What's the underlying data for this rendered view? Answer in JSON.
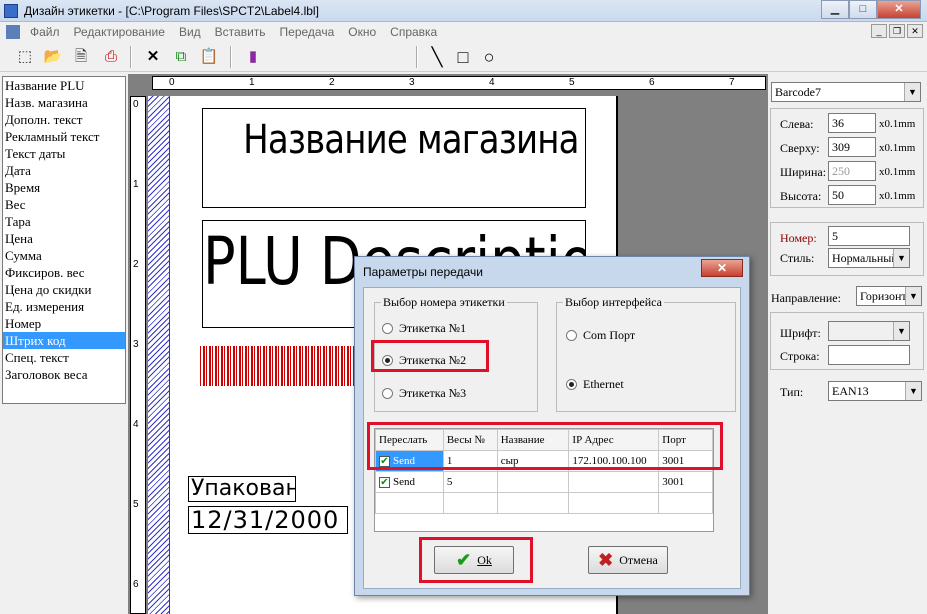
{
  "window": {
    "title": "Дизайн этикетки - [C:\\Program Files\\SPCT2\\Label4.lbl]",
    "minimize": "▁",
    "maximize": "□",
    "close": "✕"
  },
  "menu": [
    "Файл",
    "Редактирование",
    "Вид",
    "Вставить",
    "Передача",
    "Окно",
    "Справка"
  ],
  "fields": [
    "Название PLU",
    "Назв. магазина",
    "Дополн. текст",
    "Рекламный текст",
    "Текст даты",
    "Дата",
    "Время",
    "Вес",
    "Тара",
    "Цена",
    "Сумма",
    "Фиксиров. вес",
    "Цена до скидки",
    "Ед. измерения",
    "Номер",
    "Штрих код",
    "Спец. текст",
    "Заголовок веса"
  ],
  "selected_field": "Штрих код",
  "ruler": {
    "h": [
      "0",
      "1",
      "2",
      "3",
      "4",
      "5",
      "6",
      "7"
    ],
    "v": [
      "0",
      "1",
      "2",
      "3",
      "4",
      "5",
      "6"
    ]
  },
  "label": {
    "store_name": "Название магазина",
    "plu_description": "PLU Description",
    "text_packed": "Упаковано",
    "date": "12/31/2000"
  },
  "props": {
    "object": "Barcode7",
    "left_label": "Слева:",
    "left": "36",
    "top_label": "Сверху:",
    "top": "309",
    "width_label": "Ширина:",
    "width": "250",
    "height_label": "Высота:",
    "height": "50",
    "unit": "x0.1mm",
    "number_label": "Номер:",
    "number": "5",
    "style_label": "Стиль:",
    "style": "Нормальный",
    "direction_label": "Направление:",
    "direction": "Горизонт",
    "font_label": "Шрифт:",
    "font": "",
    "line_label": "Строка:",
    "line": "",
    "type_label": "Тип:",
    "type": "EAN13"
  },
  "dialog": {
    "title": "Параметры передачи",
    "close": "✕",
    "label_group": "Выбор номера этикетки",
    "label_options": [
      "Этикетка №1",
      "Этикетка №2",
      "Этикетка №3"
    ],
    "label_selected": 1,
    "iface_group": "Выбор интерфейса",
    "iface_options": [
      "Com Порт",
      "Ethernet"
    ],
    "iface_selected": 1,
    "table": {
      "headers": [
        "Переслать",
        "Весы №",
        "Название",
        "IP Адрес",
        "Порт"
      ],
      "rows": [
        [
          "Send",
          "1",
          "сыр",
          "172.100.100.100",
          "3001"
        ],
        [
          "Send",
          "5",
          "",
          "",
          "3001"
        ]
      ]
    },
    "ok": "Ok",
    "cancel": "Отмена",
    "colors": {
      "highlight": "#e0102a",
      "selection": "#3399ff"
    }
  }
}
